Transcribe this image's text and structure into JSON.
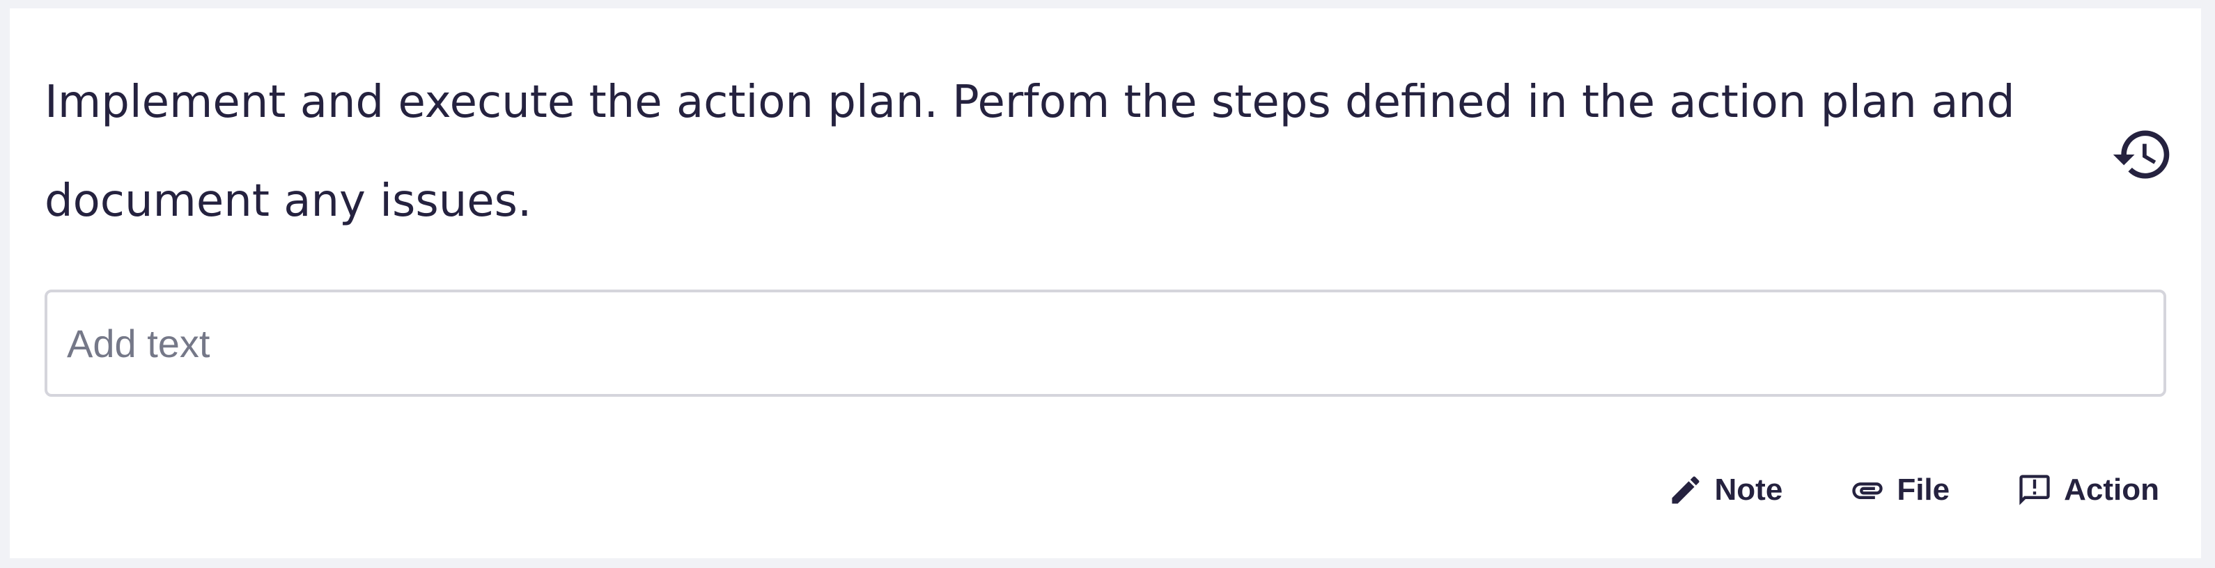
{
  "task": {
    "description": "Implement and execute the action plan. Perfom the steps defined in the action plan and document any issues.",
    "history_icon": "history-icon"
  },
  "input": {
    "placeholder": "Add text",
    "value": ""
  },
  "actions": {
    "note": {
      "label": "Note",
      "icon": "pencil-icon"
    },
    "file": {
      "label": "File",
      "icon": "paperclip-icon"
    },
    "action": {
      "label": "Action",
      "icon": "report-message-icon"
    }
  },
  "colors": {
    "text": "#25223f",
    "placeholder": "#757888",
    "border": "#d5d5dc",
    "background": "#f1f2f6",
    "card": "#ffffff"
  }
}
